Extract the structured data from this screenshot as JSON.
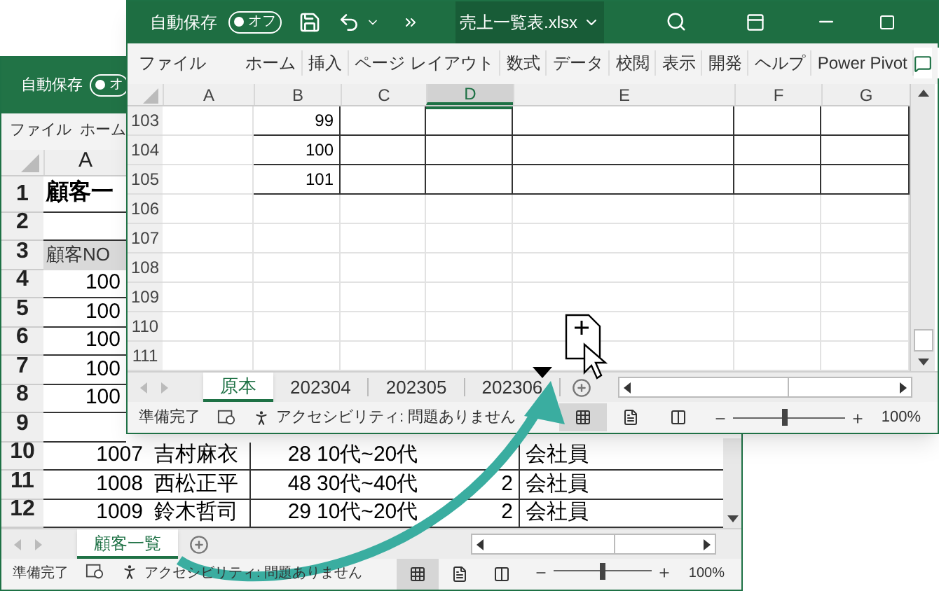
{
  "back_window": {
    "autosave_label": "自動保存",
    "autosave_toggle": "オ",
    "autosave_on": false,
    "ribbon_tabs": [
      "ファイル",
      "ホーム"
    ],
    "column_headers": [
      {
        "label": "A",
        "selected": false
      }
    ],
    "rows": [
      {
        "number": "1",
        "no": "顧客一",
        "title": true
      },
      {
        "number": "2"
      },
      {
        "number": "3",
        "no": "顧客NO",
        "header": true
      },
      {
        "number": "4",
        "no": "100"
      },
      {
        "number": "5",
        "no": "100"
      },
      {
        "number": "6",
        "no": "100"
      },
      {
        "number": "7",
        "no": "100"
      },
      {
        "number": "8",
        "no": "100"
      },
      {
        "number": "9"
      },
      {
        "number": "10",
        "no": "1007",
        "name": "吉村麻衣",
        "age": "28",
        "age_group": "10代~20代",
        "occupation": "会社員"
      },
      {
        "number": "11",
        "no": "1008",
        "name": "西松正平",
        "age": "48",
        "age_group": "30代~40代",
        "column_e": "2",
        "occupation": "会社員"
      },
      {
        "number": "12",
        "no": "1009",
        "name": "鈴木哲司",
        "age": "29",
        "age_group": "10代~20代",
        "column_e": "2",
        "occupation": "会社員"
      }
    ],
    "sheet_tabs": [
      {
        "label": "顧客一覧",
        "selected": true
      }
    ],
    "status": "準備完了",
    "accessibility": "アクセシビリティ: 問題ありません",
    "zoom": "100%",
    "zoom_level": {
      "level": 0.5
    }
  },
  "front_window": {
    "autosave_label": "自動保存",
    "autosave_toggle": "オフ",
    "autosave_on": false,
    "file_name": "売上一覧表.xlsx",
    "ribbon_tabs": [
      "ファイル",
      "ホーム",
      "挿入",
      "ページ レイアウト",
      "数式",
      "データ",
      "校閲",
      "表示",
      "開発",
      "ヘルプ",
      "Power Pivot"
    ],
    "column_headers": [
      {
        "label": "A",
        "selected": false
      },
      {
        "label": "B",
        "selected": false
      },
      {
        "label": "C",
        "selected": false
      },
      {
        "label": "D",
        "selected": true
      },
      {
        "label": "E",
        "selected": false
      },
      {
        "label": "F",
        "selected": false
      },
      {
        "label": "G",
        "selected": false
      }
    ],
    "rows": [
      {
        "number": "103",
        "b": "99",
        "bordered": true
      },
      {
        "number": "104",
        "b": "100",
        "bordered": true
      },
      {
        "number": "105",
        "b": "101",
        "bordered": true
      },
      {
        "number": "106",
        "bordered": false
      },
      {
        "number": "107",
        "bordered": false
      },
      {
        "number": "108",
        "bordered": false
      },
      {
        "number": "109",
        "bordered": false
      },
      {
        "number": "110",
        "bordered": false
      },
      {
        "number": "111",
        "bordered": false
      }
    ],
    "sheet_tabs": [
      {
        "label": "原本",
        "selected": true
      },
      {
        "label": "202304",
        "selected": false
      },
      {
        "label": "202305",
        "selected": false
      },
      {
        "label": "202306",
        "selected": false
      }
    ],
    "status": "準備完了",
    "accessibility": "アクセシビリティ: 問題ありません",
    "zoom": "100%",
    "zoom_level": {
      "level": 0.46
    }
  }
}
